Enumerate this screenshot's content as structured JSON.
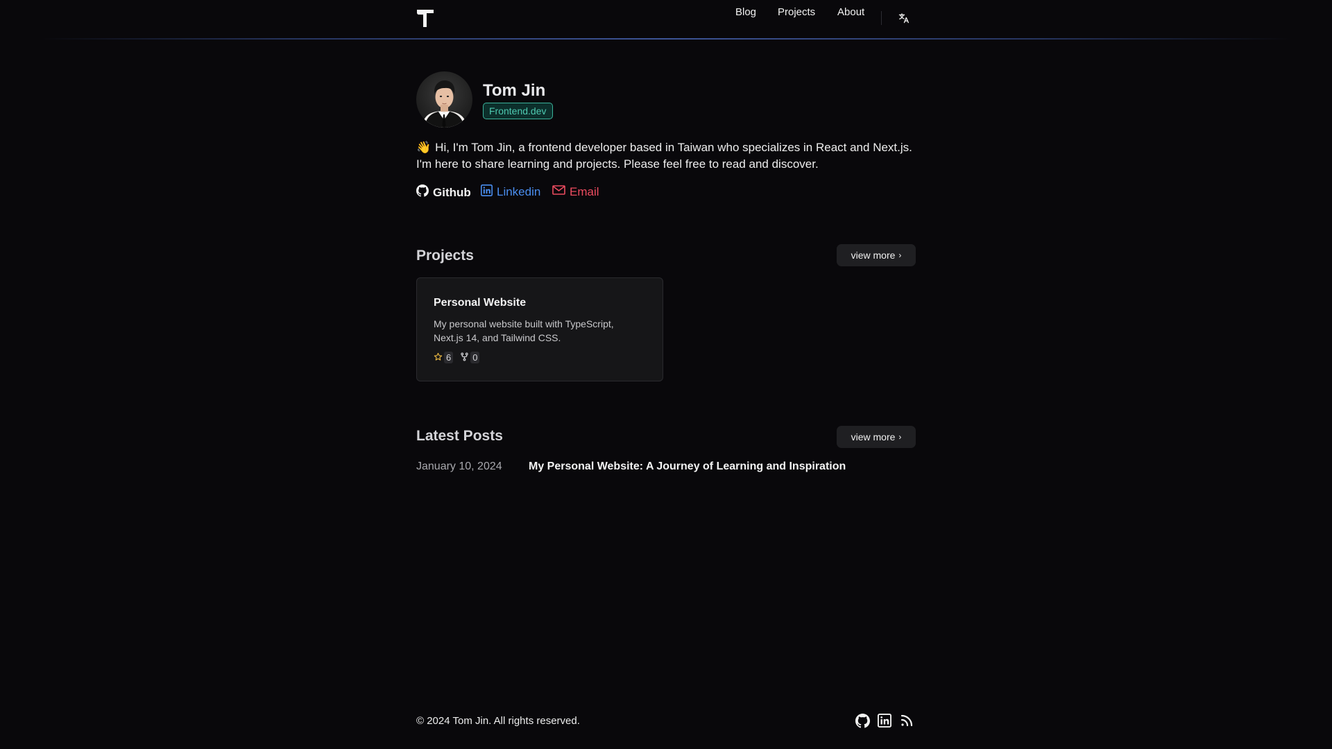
{
  "header": {
    "logo_icon": "t-logo-icon",
    "nav": {
      "blog": "Blog",
      "projects": "Projects",
      "about": "About"
    },
    "language_icon": "translate-icon"
  },
  "profile": {
    "name": "Tom Jin",
    "role": "Frontend.dev",
    "intro_emoji": "👋",
    "intro_text": "Hi, I'm Tom Jin, a frontend developer based in Taiwan who specializes in React and Next.js. I'm here to share learning and projects. Please feel free to read and discover.",
    "links": {
      "github": "Github",
      "linkedin": "Linkedin",
      "email": "Email"
    }
  },
  "projects": {
    "title": "Projects",
    "view_more": "view more",
    "items": [
      {
        "title": "Personal Website",
        "description": "My personal website built with TypeScript, Next.js 14, and Tailwind CSS.",
        "stars": "6",
        "forks": "0"
      }
    ]
  },
  "posts": {
    "title": "Latest Posts",
    "view_more": "view more",
    "items": [
      {
        "date": "January 10, 2024",
        "title": "My Personal Website: A Journey of Learning and Inspiration"
      }
    ]
  },
  "footer": {
    "copyright": "© 2024 Tom Jin. All rights reserved.",
    "icons": [
      "github-icon",
      "linkedin-icon",
      "rss-icon"
    ]
  },
  "colors": {
    "background": "#09080b",
    "accent_teal": "#4ec9b0",
    "linkedin_blue": "#4a8ef0",
    "email_red": "#ec4b5f",
    "card_bg": "#161618"
  }
}
